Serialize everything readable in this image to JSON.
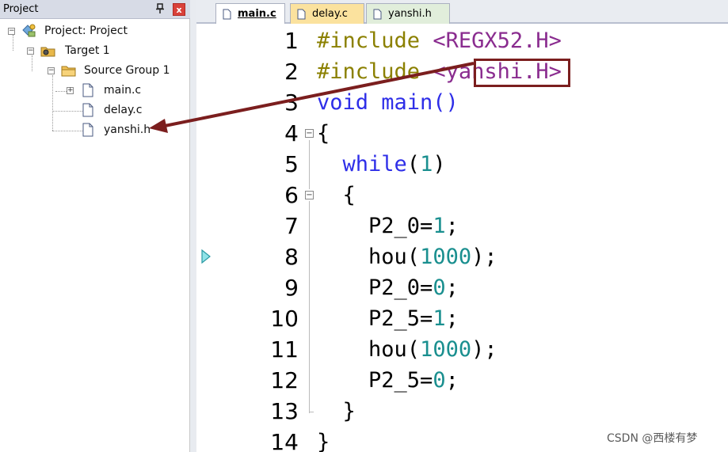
{
  "project_panel": {
    "title": "Project",
    "close_label": "x",
    "tree": {
      "project": "Project: Project",
      "target": "Target 1",
      "group": "Source Group 1",
      "files": [
        "main.c",
        "delay.c",
        "yanshi.h"
      ]
    }
  },
  "tabs": [
    {
      "label": "main.c",
      "active": true
    },
    {
      "label": "delay.c",
      "active": false
    },
    {
      "label": "yanshi.h",
      "active": false
    }
  ],
  "editor": {
    "line_numbers": [
      "1",
      "2",
      "3",
      "4",
      "5",
      "6",
      "7",
      "8",
      "9",
      "10",
      "11",
      "12",
      "13",
      "14"
    ],
    "lines": {
      "l1_directive": "#include",
      "l1_header": "<REGX52.H>",
      "l2_directive": "#include",
      "l2_header_open": "<",
      "l2_header_name": "yanshi",
      "l2_header_close": ".H>",
      "l3": "void main()",
      "l4": "{",
      "l5_kw": "while",
      "l5_open": "(",
      "l5_num": "1",
      "l5_close": ")",
      "l6": "{",
      "l7_a": "P2_0=",
      "l7_num": "1",
      "l7_b": ";",
      "l8_a": "hou(",
      "l8_num": "1000",
      "l8_b": ");",
      "l9_a": "P2_0=",
      "l9_num": "0",
      "l9_b": ";",
      "l10_a": "P2_5=",
      "l10_num": "1",
      "l10_b": ";",
      "l11_a": "hou(",
      "l11_num": "1000",
      "l11_b": ");",
      "l12_a": "P2_5=",
      "l12_num": "0",
      "l12_b": ";",
      "l13": "}",
      "l14": "}"
    }
  },
  "watermark": "CSDN @西楼有梦",
  "colors": {
    "annotation": "#7b1e1e",
    "preprocessor": "#8b8000",
    "string": "#8a2c8f",
    "keyword": "#2e2ee8",
    "number": "#1a8f8f"
  }
}
